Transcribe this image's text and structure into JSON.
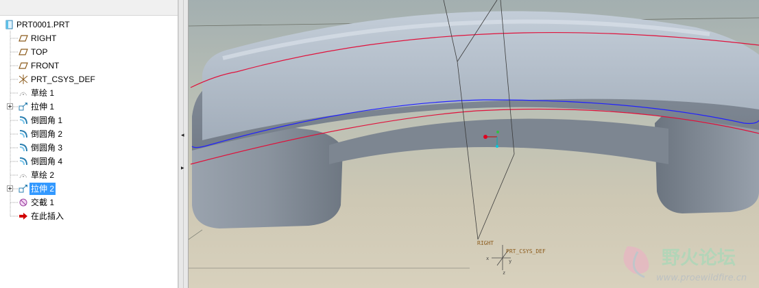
{
  "model_tree": {
    "root": "PRT0001.PRT",
    "items": [
      {
        "label": "RIGHT",
        "icon": "datum-plane-icon"
      },
      {
        "label": "TOP",
        "icon": "datum-plane-icon"
      },
      {
        "label": "FRONT",
        "icon": "datum-plane-icon"
      },
      {
        "label": "PRT_CSYS_DEF",
        "icon": "csys-icon"
      },
      {
        "label": "草绘 1",
        "icon": "sketch-icon"
      },
      {
        "label": "拉伸 1",
        "icon": "extrude-icon"
      },
      {
        "label": "倒圆角 1",
        "icon": "round-icon"
      },
      {
        "label": "倒圆角 2",
        "icon": "round-icon"
      },
      {
        "label": "倒圆角 3",
        "icon": "round-icon"
      },
      {
        "label": "倒圆角 4",
        "icon": "round-icon"
      },
      {
        "label": "草绘 2",
        "icon": "sketch-icon"
      },
      {
        "label": "拉伸 2",
        "icon": "extrude-icon",
        "selected": true
      },
      {
        "label": "交截 1",
        "icon": "intersect-icon"
      },
      {
        "label": "在此插入",
        "icon": "insert-arrow-icon"
      }
    ]
  },
  "viewport": {
    "datum_plane_label": "RIGHT",
    "csys_label": "PRT_CSYS_DEF",
    "axis_x": "x",
    "axis_y": "y",
    "axis_z": "z"
  },
  "watermark": {
    "title": "野火论坛",
    "url": "www.proewildfire.cn"
  },
  "colors": {
    "selection": "#3399ff",
    "model_gray": "#9aa3ad",
    "curve_red": "#e0103a",
    "curve_blue": "#2020ff",
    "datum_text": "#8b5a1a"
  }
}
